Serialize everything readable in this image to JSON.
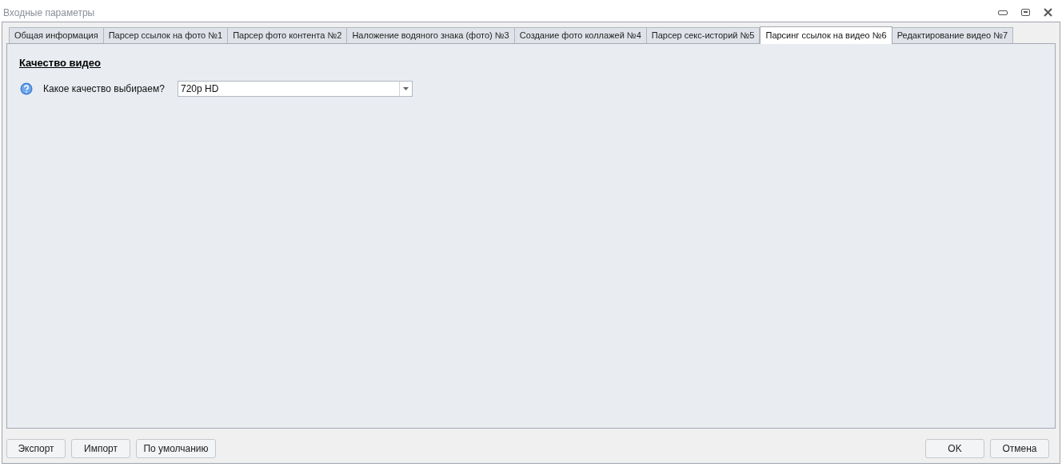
{
  "window": {
    "title": "Входные параметры"
  },
  "tabs": [
    {
      "label": "Общая информация",
      "selected": false
    },
    {
      "label": "Парсер ссылок на фото №1",
      "selected": false
    },
    {
      "label": "Парсер фото контента №2",
      "selected": false
    },
    {
      "label": "Наложение водяного знака (фото) №3",
      "selected": false
    },
    {
      "label": "Создание фото коллажей №4",
      "selected": false
    },
    {
      "label": "Парсер секс-историй №5",
      "selected": false
    },
    {
      "label": "Парсинг ссылок на видео №6",
      "selected": true
    },
    {
      "label": "Редактирование видео №7",
      "selected": false
    }
  ],
  "section": {
    "title": "Качество видео",
    "fields": [
      {
        "label": "Какое качество выбираем?",
        "value": "720p HD"
      }
    ]
  },
  "left_buttons": [
    "Экспорт",
    "Импорт",
    "По умолчанию"
  ],
  "right_buttons": [
    "OK",
    "Отмена"
  ]
}
